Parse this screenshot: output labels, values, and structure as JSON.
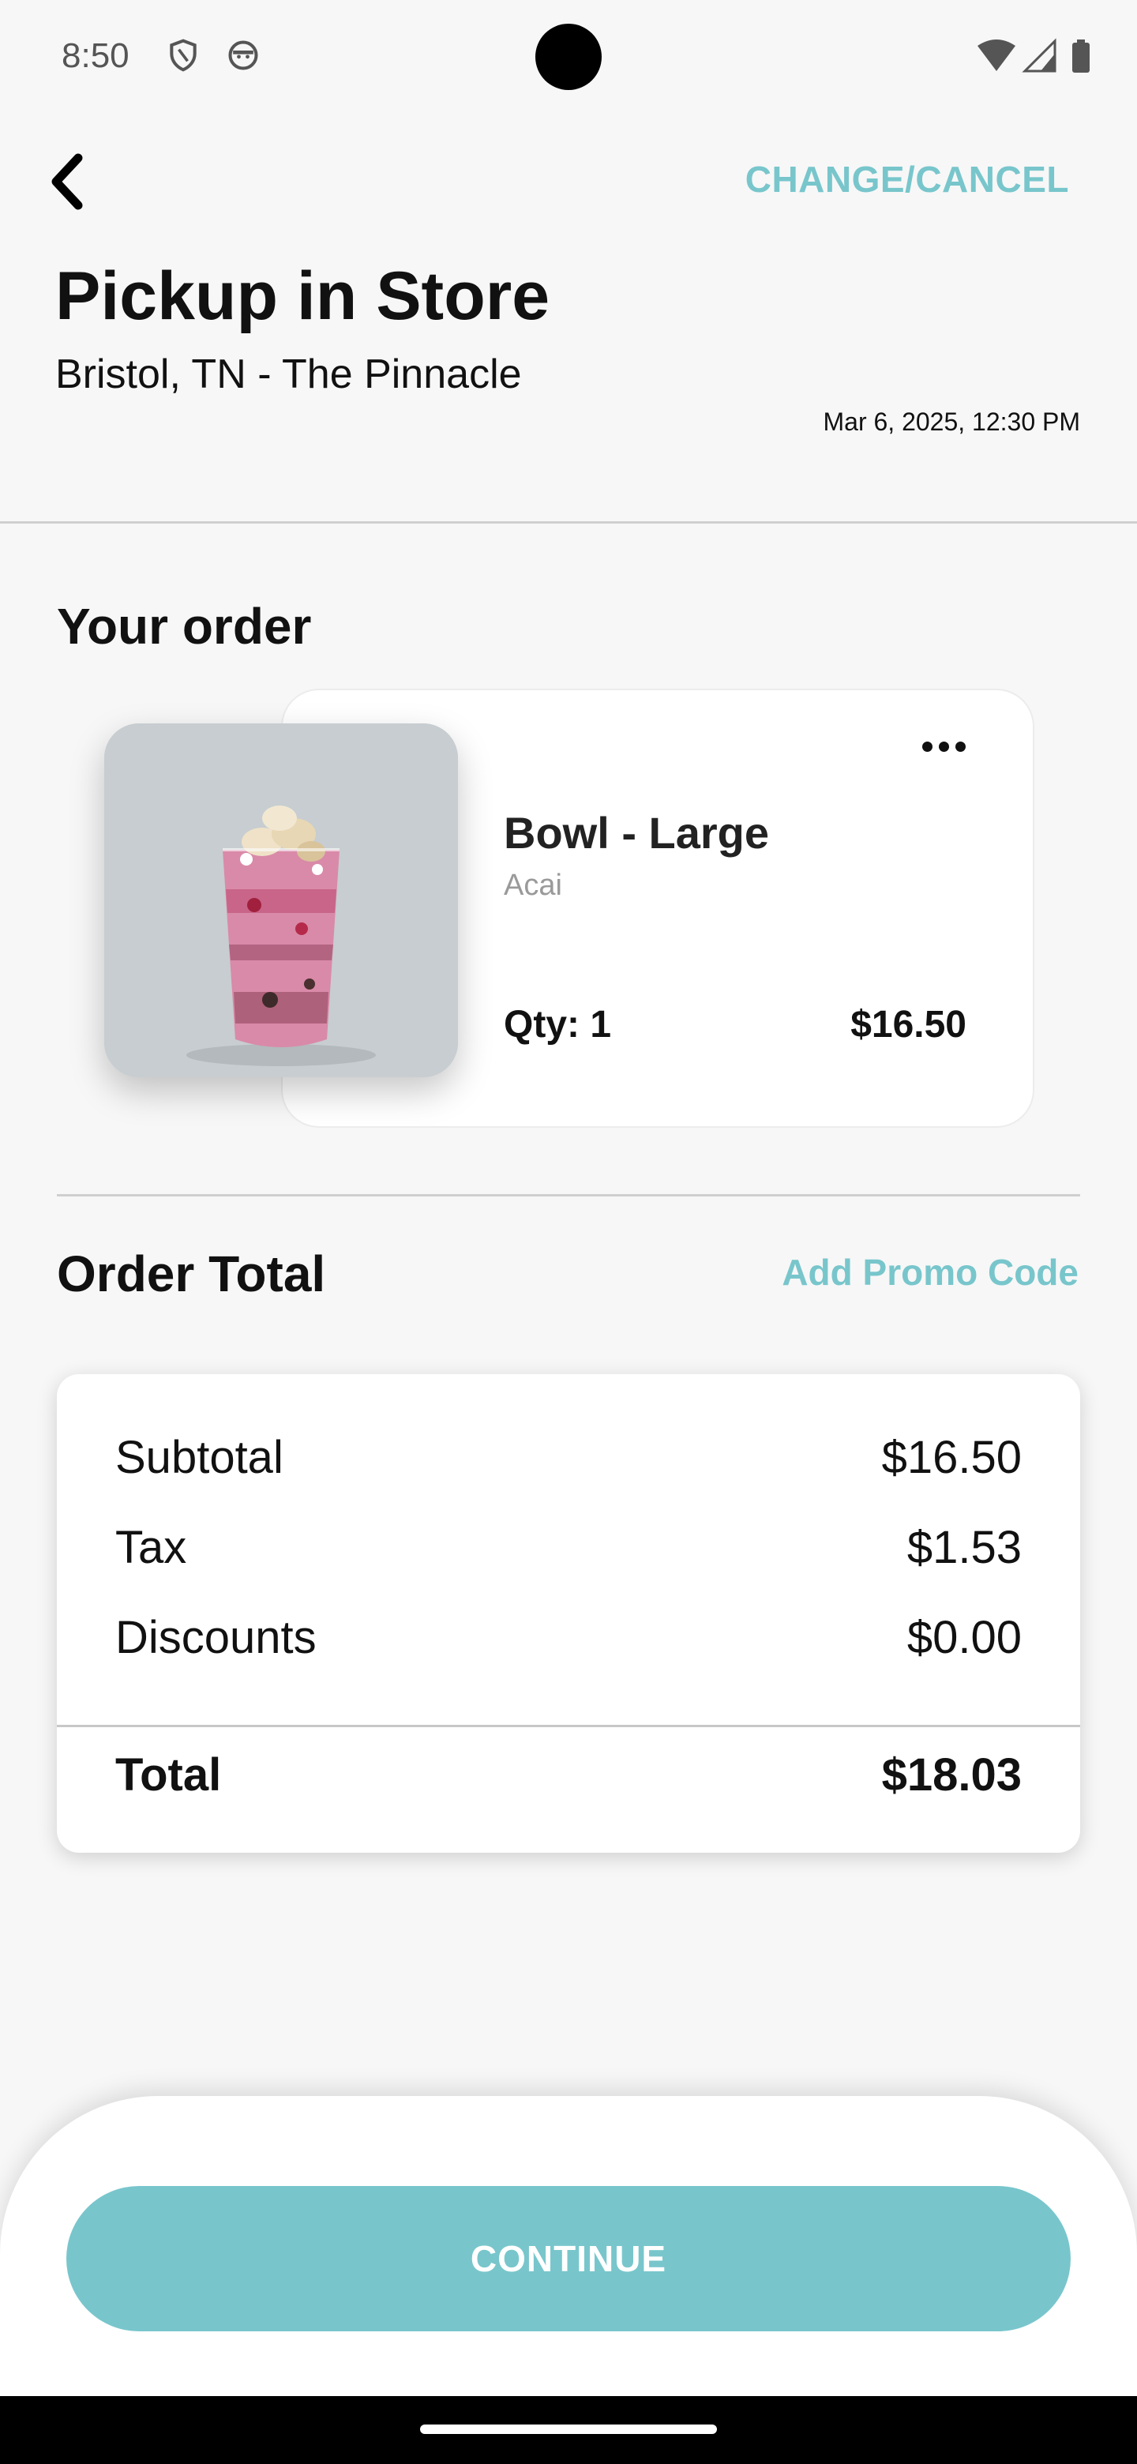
{
  "status_bar": {
    "time": "8:50",
    "icons": [
      "shield-icon",
      "face-icon",
      "wifi-icon",
      "signal-icon",
      "battery-icon"
    ]
  },
  "header": {
    "back_icon": "chevron-left-icon",
    "change_cancel_label": "CHANGE/CANCEL",
    "title": "Pickup in Store",
    "store_name": "Bristol, TN - The Pinnacle",
    "pickup_time": "Mar 6, 2025, 12:30 PM"
  },
  "order": {
    "section_title": "Your order",
    "items": [
      {
        "name": "Bowl - Large",
        "subtitle": "Acai",
        "qty": "Qty: 1",
        "price": "$16.50",
        "more_icon": "more-horizontal-icon"
      }
    ]
  },
  "totals": {
    "section_title": "Order Total",
    "promo_label": "Add Promo Code",
    "subtotal_label": "Subtotal",
    "subtotal_value": "$16.50",
    "tax_label": "Tax",
    "tax_value": "$1.53",
    "discounts_label": "Discounts",
    "discounts_value": "$0.00",
    "total_label": "Total",
    "total_value": "$18.03"
  },
  "footer": {
    "continue_label": "CONTINUE"
  },
  "colors": {
    "accent": "#78c6cc",
    "background": "#f7f7f7",
    "text": "#111111"
  }
}
